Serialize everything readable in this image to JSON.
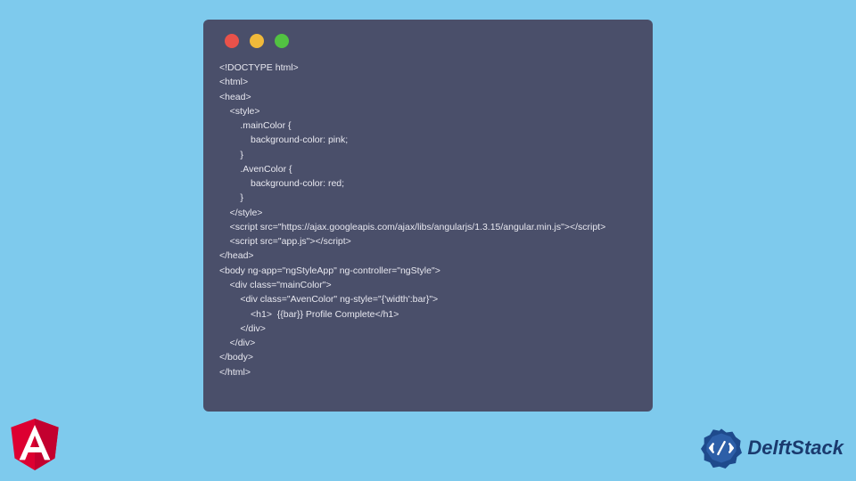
{
  "codeWindow": {
    "lights": [
      "red",
      "yellow",
      "green"
    ],
    "code": "<!DOCTYPE html>\n<html>\n<head>\n    <style>\n        .mainColor {\n            background-color: pink;\n        }\n        .AvenColor {\n            background-color: red;\n        }\n    </style>\n    <script src=\"https://ajax.googleapis.com/ajax/libs/angularjs/1.3.15/angular.min.js\"></script>\n    <script src=\"app.js\"></script>\n</head>\n<body ng-app=\"ngStyleApp\" ng-controller=\"ngStyle\">\n    <div class=\"mainColor\">\n        <div class=\"AvenColor\" ng-style=\"{'width':bar}\">\n            <h1>  {{bar}} Profile Complete</h1>\n        </div>\n    </div>\n</body>\n</html>"
  },
  "logos": {
    "angular": "A",
    "delftstack": "DelftStack"
  }
}
